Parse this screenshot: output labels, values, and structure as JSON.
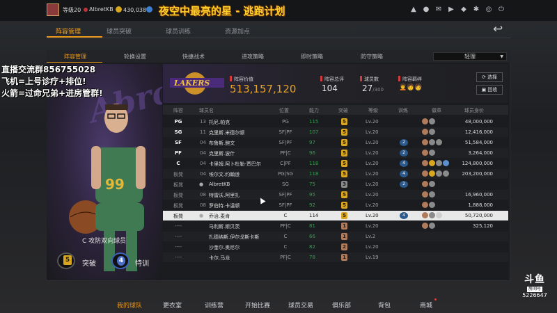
{
  "stream_title": "夜空中最亮的星 - 逃跑计划",
  "topbar": {
    "level": "等级20",
    "username": "AlbretKB",
    "coins": "430,038",
    "coin_color": "#d9a620",
    "heart_color": "#c0323a"
  },
  "overlay": {
    "line1": "直播交流群856755028",
    "line2": "飞机=上号诊疗+排位!",
    "line3": "火箭=过命兄弟+进房管群!"
  },
  "main_tabs": [
    "阵容管理",
    "球员突破",
    "球员训练",
    "资源加点"
  ],
  "sub_tabs": [
    "阵容管理",
    "轮换设置",
    "快捷战术",
    "进攻策略",
    "防守策略",
    "防守策略"
  ],
  "dropdown_value": "轻理",
  "player_card": {
    "role": "C 攻防双向球员",
    "breakthrough_level": "5",
    "breakthrough_label": "突破",
    "training_level": "4",
    "training_label": "特训",
    "jersey": "99",
    "team_text": "LAKERS"
  },
  "summary": {
    "value_label": "阵容价值",
    "value": "513,157,120",
    "rating_label": "阵容总评",
    "rating": "104",
    "count_label": "球员数",
    "count": "27",
    "count_max": "/300",
    "bonds_label": "阵容羁绊",
    "bonds_icons": "🧑‍🦱🧑🧑",
    "btn_select": "选择",
    "btn_recycle": "回收"
  },
  "table": {
    "headers": [
      "阵容",
      "球员名",
      "位置",
      "能力",
      "突破",
      "等级",
      "训练",
      "徽章",
      "球员身价"
    ],
    "rows": [
      {
        "slot": "PG",
        "num": "13",
        "name": "托尼.帕克",
        "pos": "PG",
        "ovr": "115",
        "brk": "5",
        "brk_color": "#d9a620",
        "lv": "Lv.20",
        "train": "",
        "badges": [
          "#b07b5a",
          "#8a8a8a"
        ],
        "salary": "48,000,000",
        "starter": true
      },
      {
        "slot": "SG",
        "num": "11",
        "name": "克里斯.米德尔顿",
        "pos": "SF|PF",
        "ovr": "107",
        "brk": "5",
        "brk_color": "#d9a620",
        "lv": "Lv.20",
        "train": "",
        "badges": [
          "#b07b5a",
          "#8a8a8a"
        ],
        "salary": "12,416,000",
        "starter": true
      },
      {
        "slot": "SF",
        "num": "04",
        "name": "布鲁斯.鲍文",
        "pos": "SF|PF",
        "ovr": "97",
        "brk": "5",
        "brk_color": "#d9a620",
        "lv": "Lv.20",
        "train": "2",
        "badges": [
          "#b07b5a",
          "#8a8a8a",
          "#8a8a8a"
        ],
        "salary": "51,584,000",
        "starter": true
      },
      {
        "slot": "PF",
        "num": "04",
        "name": "克里斯.波什",
        "pos": "PF|C",
        "ovr": "96",
        "brk": "5",
        "brk_color": "#d9a620",
        "lv": "Lv.20",
        "train": "2",
        "badges": [
          "#b07b5a",
          "#8a8a8a"
        ],
        "salary": "3,264,000",
        "starter": true
      },
      {
        "slot": "C",
        "num": "04",
        "name": "卡里姆.阿卜杜勒-贾巴尔",
        "pos": "C|PF",
        "ovr": "118",
        "brk": "5",
        "brk_color": "#d9a620",
        "lv": "Lv.20",
        "train": "4",
        "badges": [
          "#b07b5a",
          "#d9a620",
          "#8a8a8a",
          "#5b8fd0"
        ],
        "salary": "124,800,000",
        "starter": true
      },
      {
        "slot": "板凳",
        "num": "04",
        "name": "埃尔文.约翰逊",
        "pos": "PG|SG",
        "ovr": "118",
        "brk": "5",
        "brk_color": "#d9a620",
        "lv": "Lv.20",
        "train": "4",
        "badges": [
          "#b07b5a",
          "#d9a620",
          "#8a8a8a",
          "#8a8a8a"
        ],
        "salary": "203,200,000",
        "starter": false
      },
      {
        "slot": "板凳",
        "num": "",
        "name": "AlbretKB",
        "pos": "SG",
        "ovr": "75",
        "brk": "3",
        "brk_color": "#8a8a8a",
        "lv": "Lv.20",
        "train": "2",
        "badges": [
          "#b07b5a",
          "#8a8a8a"
        ],
        "salary": "",
        "starter": false
      },
      {
        "slot": "板凳",
        "num": "08",
        "name": "特雷沃.阿里扎",
        "pos": "SF|PF",
        "ovr": "95",
        "brk": "5",
        "brk_color": "#d9a620",
        "lv": "Lv.20",
        "train": "",
        "badges": [
          "#b07b5a",
          "#8a8a8a"
        ],
        "salary": "16,960,000",
        "starter": false
      },
      {
        "slot": "板凳",
        "num": "08",
        "name": "罗伯特.卡温顿",
        "pos": "SF|PF",
        "ovr": "92",
        "brk": "5",
        "brk_color": "#d9a620",
        "lv": "Lv.20",
        "train": "",
        "badges": [
          "#b07b5a",
          "#8a8a8a"
        ],
        "salary": "1,888,000",
        "starter": false
      },
      {
        "slot": "板凳",
        "num": "",
        "name": "乔治.麦肯",
        "pos": "C",
        "ovr": "114",
        "brk": "5",
        "brk_color": "#d9a620",
        "lv": "Lv.20",
        "train": "4",
        "badges": [
          "#b07b5a",
          "#8a8a8a",
          "#cfcfcf"
        ],
        "salary": "50,720,000",
        "starter": false,
        "selected": true
      },
      {
        "slot": "----",
        "num": "",
        "name": "马利斯.斯贝茨",
        "pos": "PF|C",
        "ovr": "81",
        "brk": "1",
        "brk_color": "#b07b5a",
        "lv": "Lv.20",
        "train": "",
        "badges": [
          "#b07b5a",
          "#8a8a8a"
        ],
        "salary": "325,120",
        "starter": false
      },
      {
        "slot": "----",
        "num": "",
        "name": "扎德纳斯.伊尔戈斯卡斯",
        "pos": "C",
        "ovr": "66",
        "brk": "1",
        "brk_color": "#b07b5a",
        "lv": "Lv.2",
        "train": "",
        "badges": [],
        "salary": "",
        "starter": false
      },
      {
        "slot": "----",
        "num": "",
        "name": "沙奎尔.奥尼尔",
        "pos": "C",
        "ovr": "82",
        "brk": "2",
        "brk_color": "#b07b5a",
        "lv": "Lv.20",
        "train": "",
        "badges": [],
        "salary": "",
        "starter": false
      },
      {
        "slot": "----",
        "num": "",
        "name": "卡尔.马龙",
        "pos": "PF|C",
        "ovr": "78",
        "brk": "1",
        "brk_color": "#b07b5a",
        "lv": "Lv.19",
        "train": "",
        "badges": [],
        "salary": "",
        "starter": false
      }
    ]
  },
  "bottom_nav": [
    "我的球队",
    "更衣室",
    "训练营",
    "开始比赛",
    "球员交易",
    "俱乐部",
    "背包",
    "商城"
  ],
  "room": {
    "brand": "斗鱼",
    "label": "房间号",
    "id": "5226647"
  }
}
